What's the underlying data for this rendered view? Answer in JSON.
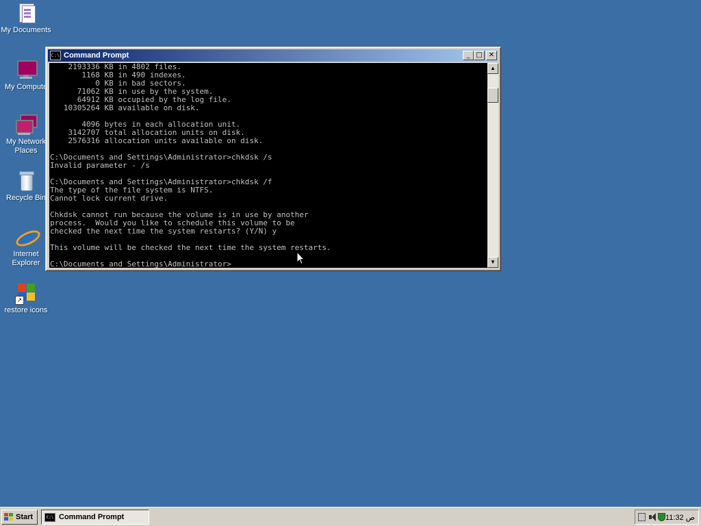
{
  "desktop": {
    "icons": [
      {
        "label": "My Documents"
      },
      {
        "label": "My Compute"
      },
      {
        "label": "My Network Places"
      },
      {
        "label": "Recycle Bin"
      },
      {
        "label": "Internet Explorer"
      },
      {
        "label": "restore icons"
      }
    ]
  },
  "window": {
    "title": "Command Prompt",
    "icon_text": "C:\\",
    "buttons": {
      "minimize": "_",
      "maximize": "□",
      "close": "✕"
    },
    "console_lines": [
      "    2193336 KB in 4802 files.",
      "       1168 KB in 490 indexes.",
      "          0 KB in bad sectors.",
      "      71062 KB in use by the system.",
      "      64912 KB occupied by the log file.",
      "   10305264 KB available on disk.",
      "",
      "       4096 bytes in each allocation unit.",
      "    3142707 total allocation units on disk.",
      "    2576316 allocation units available on disk.",
      "",
      "C:\\Documents and Settings\\Administrator>chkdsk /s",
      "Invalid parameter - /s",
      "",
      "C:\\Documents and Settings\\Administrator>chkdsk /f",
      "The type of the file system is NTFS.",
      "Cannot lock current drive.",
      "",
      "Chkdsk cannot run because the volume is in use by another",
      "process.  Would you like to schedule this volume to be",
      "checked the next time the system restarts? (Y/N) y",
      "",
      "This volume will be checked the next time the system restarts.",
      "",
      "C:\\Documents and Settings\\Administrator>"
    ],
    "scroll": {
      "up_glyph": "▲",
      "down_glyph": "▼"
    }
  },
  "taskbar": {
    "start_label": "Start",
    "task_label": "Command Prompt",
    "clock": "11:32 ص"
  },
  "icons": {
    "window_icon": "cmd-icon",
    "tray": [
      "network-icon",
      "volume-icon",
      "security-shield-icon"
    ]
  }
}
